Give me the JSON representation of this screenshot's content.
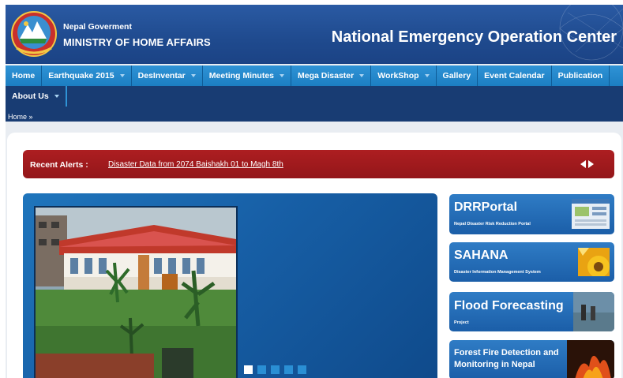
{
  "header": {
    "gov_line1": "Nepal Goverment",
    "gov_line2": "MINISTRY OF HOME AFFAIRS",
    "center_title": "National Emergency Operation Center"
  },
  "nav": {
    "items": [
      {
        "label": "Home",
        "dropdown": false
      },
      {
        "label": "Earthquake 2015",
        "dropdown": true
      },
      {
        "label": "DesInventar",
        "dropdown": true
      },
      {
        "label": "Meeting Minutes",
        "dropdown": true
      },
      {
        "label": "Mega Disaster",
        "dropdown": true
      },
      {
        "label": "WorkShop",
        "dropdown": true
      },
      {
        "label": "Gallery",
        "dropdown": false
      },
      {
        "label": "Event Calendar",
        "dropdown": false
      },
      {
        "label": "Publication",
        "dropdown": false
      }
    ],
    "row2": [
      {
        "label": "About Us",
        "dropdown": true
      }
    ]
  },
  "breadcrumb": "Home »",
  "alerts": {
    "label": "Recent Alerts :",
    "link": "Disaster Data from 2074 Baishakh 01 to Magh 8th"
  },
  "slider": {
    "total_slides": 5,
    "active_slide": 1
  },
  "portals": [
    {
      "title": "DRRPortal",
      "subtitle": "Nepal Disaster Risk Reduction Portal"
    },
    {
      "title": "SAHANA",
      "subtitle": "Disaster Information Management System"
    },
    {
      "title": "Flood Forecasting",
      "subtitle": "Project"
    },
    {
      "title": "Forest Fire Detection and Monitoring in Nepal",
      "subtitle": ""
    }
  ],
  "colors": {
    "header_blue": "#1f4a8e",
    "nav_blue": "#1c7ec2",
    "nav_dark": "#183c73",
    "alert_red": "#a31c1f"
  }
}
